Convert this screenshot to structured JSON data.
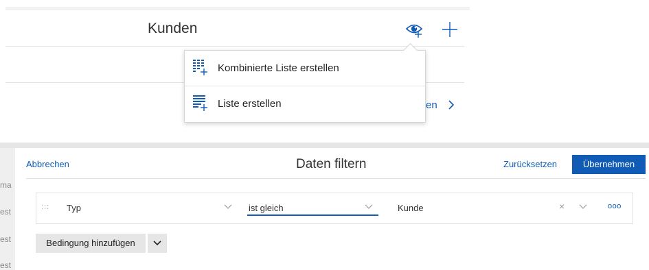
{
  "top": {
    "title": "Kunden",
    "partial_link": "en",
    "menu": {
      "items": [
        {
          "label": "Kombinierte Liste erstellen",
          "icon": "combined-list-add-icon"
        },
        {
          "label": "Liste erstellen",
          "icon": "list-add-icon"
        }
      ]
    }
  },
  "filter_dialog": {
    "cancel_label": "Abbrechen",
    "title": "Daten filtern",
    "reset_label": "Zurücksetzen",
    "apply_label": "Übernehmen",
    "condition": {
      "field": "Typ",
      "operator": "ist gleich",
      "value": "Kunde",
      "clear_symbol": "×",
      "more_symbol": "ooo"
    },
    "add_condition_label": "Bedingung hinzufügen"
  },
  "background_edge_text": [
    "ma",
    "est",
    "est",
    "est"
  ],
  "colors": {
    "accent": "#0f5bb5",
    "apply_bg": "#0f5bb5"
  }
}
